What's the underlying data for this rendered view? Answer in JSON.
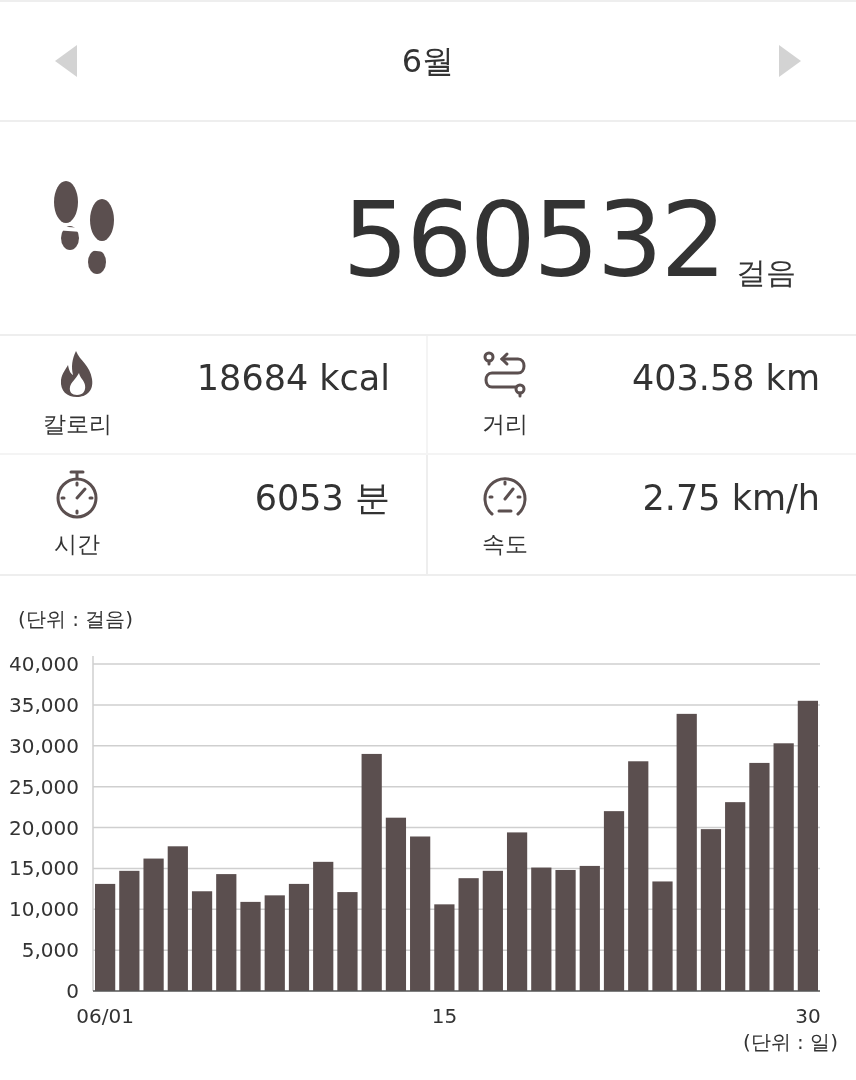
{
  "header": {
    "month": "6월"
  },
  "steps": {
    "value": "560532",
    "unit": "걸음"
  },
  "stats": [
    {
      "kind": "calories",
      "value": "18684 kcal",
      "label": "칼로리"
    },
    {
      "kind": "distance",
      "value": "403.58 km",
      "label": "거리"
    },
    {
      "kind": "time",
      "value": "6053 분",
      "label": "시간"
    },
    {
      "kind": "speed",
      "value": "2.75 km/h",
      "label": "속도"
    }
  ],
  "chart": {
    "unit_label": "(단위 : 걸음)",
    "x_unit_label": "(단위 : 일)",
    "chart_data": {
      "type": "bar",
      "x": [
        1,
        2,
        3,
        4,
        5,
        6,
        7,
        8,
        9,
        10,
        11,
        12,
        13,
        14,
        15,
        16,
        17,
        18,
        19,
        20,
        21,
        22,
        23,
        24,
        25,
        26,
        27,
        28,
        29,
        30
      ],
      "grid": true,
      "xlim": [
        0.5,
        30.5
      ],
      "series": [
        {
          "color": "#5b4f4f",
          "values": [
            13100,
            14700,
            16200,
            17700,
            12200,
            14300,
            10900,
            11700,
            13100,
            15800,
            12100,
            29000,
            21200,
            18900,
            10600,
            13800,
            14700,
            19400,
            15100,
            14800,
            15300,
            22000,
            28100,
            13400,
            33900,
            19800,
            23100,
            27900,
            30300,
            35500
          ]
        }
      ],
      "ylim": [
        0,
        40000
      ],
      "yticks": [
        {
          "value": 0,
          "label": "0"
        },
        {
          "value": 5000,
          "label": "5,000"
        },
        {
          "value": 10000,
          "label": "10,000"
        },
        {
          "value": 15000,
          "label": "15,000"
        },
        {
          "value": 20000,
          "label": "20,000"
        },
        {
          "value": 25000,
          "label": "25,000"
        },
        {
          "value": 30000,
          "label": "30,000"
        },
        {
          "value": 35000,
          "label": "35,000"
        },
        {
          "value": 40000,
          "label": "40,000"
        }
      ],
      "xticks": [
        {
          "value": 1,
          "label": "06/01"
        },
        {
          "value": 15,
          "label": "15"
        },
        {
          "value": 30,
          "label": "30"
        }
      ]
    }
  }
}
